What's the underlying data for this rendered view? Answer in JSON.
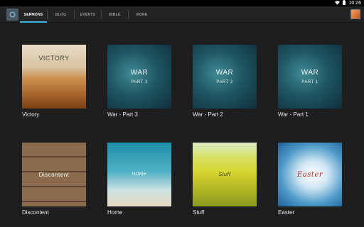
{
  "status": {
    "time": "10:26"
  },
  "tabs": [
    {
      "label": "SERMONS",
      "active": true
    },
    {
      "label": "BLOG",
      "active": false
    },
    {
      "label": "EVENTS",
      "active": false
    },
    {
      "label": "BIBLE",
      "active": false
    },
    {
      "label": "MORE",
      "active": false
    }
  ],
  "sermons": [
    {
      "caption": "Victory",
      "art_title": "VICTORY",
      "art_sub": ""
    },
    {
      "caption": "War - Part 3",
      "art_title": "WAR",
      "art_sub": "PART 3"
    },
    {
      "caption": "War - Part 2",
      "art_title": "WAR",
      "art_sub": "PART 2"
    },
    {
      "caption": "War - Part 1",
      "art_title": "WAR",
      "art_sub": "PART 1"
    },
    {
      "caption": "Discontent",
      "art_title": "Discontent",
      "art_sub": ""
    },
    {
      "caption": "Home",
      "art_title": "HOME",
      "art_sub": ""
    },
    {
      "caption": "Stuff",
      "art_title": "Stuff",
      "art_sub": ""
    },
    {
      "caption": "Easter",
      "art_title": "Easter",
      "art_sub": ""
    }
  ],
  "colors": {
    "accent": "#33b5e5",
    "background": "#1e1e1e",
    "actionbar": "#232323"
  },
  "icons": {
    "app": "app-logo-icon",
    "wifi": "wifi-icon",
    "battery": "battery-icon"
  }
}
